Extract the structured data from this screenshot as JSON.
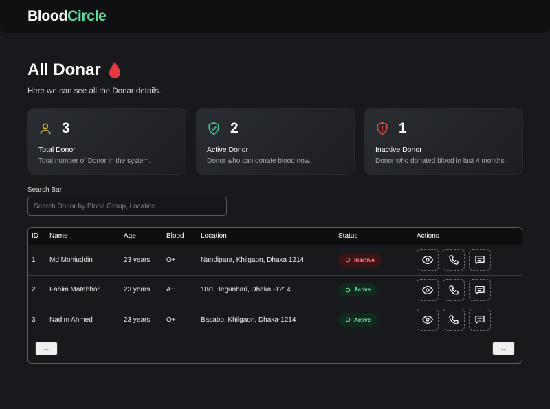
{
  "brand": {
    "part1": "Blood",
    "part2": "Circle"
  },
  "page": {
    "title": "All Donar",
    "subtitle": "Here we can see all the Donar details."
  },
  "stats": [
    {
      "icon": "user-icon",
      "count": "3",
      "title": "Total Donor",
      "desc": "Total number of Donor in the system.",
      "color": "#c9b43a"
    },
    {
      "icon": "shield-check-icon",
      "count": "2",
      "title": "Active Donor",
      "desc": "Donor who can donate blood now.",
      "color": "#3fc38a"
    },
    {
      "icon": "shield-alert-icon",
      "count": "1",
      "title": "Inactive Donor",
      "desc": "Donor who donated blood in last 4 months.",
      "color": "#e24a4a"
    }
  ],
  "search": {
    "label": "Search Bar",
    "placeholder": "Search Donor by Blood Group, Location",
    "value": ""
  },
  "table": {
    "headers": {
      "id": "ID",
      "name": "Name",
      "age": "Age",
      "blood": "Blood",
      "location": "Location",
      "status": "Status",
      "actions": "Actions"
    },
    "rows": [
      {
        "id": "1",
        "name": "Md Mohiuddin",
        "age": "23 years",
        "blood": "O+",
        "location": "Nandipara, Khilgaon, Dhaka 1214",
        "status": "Inactive"
      },
      {
        "id": "2",
        "name": "Fahim Matabbor",
        "age": "23 years",
        "blood": "A+",
        "location": "18/1 Begunbari, Dhaka -1214",
        "status": "Active"
      },
      {
        "id": "3",
        "name": "Nadim Ahmed",
        "age": "23 years",
        "blood": "O+",
        "location": "Basabo, Khilgaon, Dhaka-1214",
        "status": "Active"
      }
    ],
    "actions": [
      "view-icon",
      "phone-icon",
      "message-icon"
    ]
  },
  "pagination": {
    "prev": "←",
    "next": "→"
  },
  "colors": {
    "accent": "#5ee0a0",
    "danger": "#e24a4a",
    "background": "#17191c"
  }
}
